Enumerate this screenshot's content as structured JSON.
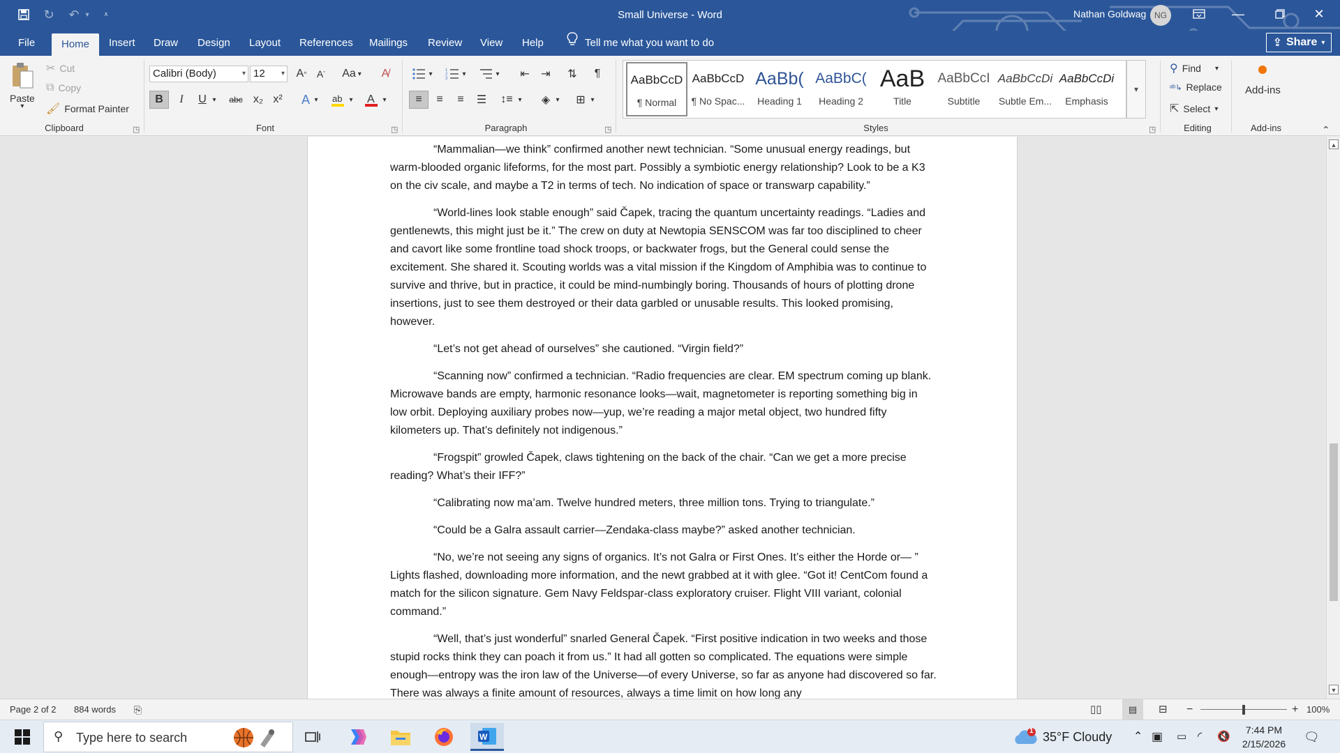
{
  "app": {
    "doc_title": "Small Universe  -  Word",
    "user_name": "Nathan Goldwag",
    "user_initials": "NG"
  },
  "menu": {
    "tabs": [
      "File",
      "Home",
      "Insert",
      "Draw",
      "Design",
      "Layout",
      "References",
      "Mailings",
      "Review",
      "View",
      "Help"
    ],
    "active_tab": "Home",
    "tell_me": "Tell me what you want to do",
    "share": "Share"
  },
  "ribbon": {
    "clipboard": {
      "paste": "Paste",
      "cut": "Cut",
      "copy": "Copy",
      "format_painter": "Format Painter",
      "label": "Clipboard"
    },
    "font": {
      "font_name": "Calibri (Body)",
      "font_size": "12",
      "label": "Font",
      "change_case": "Aa",
      "bold": "B",
      "italic": "I",
      "underline": "U",
      "strikethrough": "abc",
      "subscript": "x₂",
      "superscript": "x²"
    },
    "paragraph": {
      "label": "Paragraph"
    },
    "styles": {
      "label": "Styles",
      "items": [
        {
          "sample": "AaBbCcD",
          "name": "¶ Normal"
        },
        {
          "sample": "AaBbCcD",
          "name": "¶ No Spac..."
        },
        {
          "sample": "AaBb(",
          "name": "Heading 1"
        },
        {
          "sample": "AaBbC(",
          "name": "Heading 2"
        },
        {
          "sample": "AaB",
          "name": "Title"
        },
        {
          "sample": "AaBbCcI",
          "name": "Subtitle"
        },
        {
          "sample": "AaBbCcDi",
          "name": "Subtle Em..."
        },
        {
          "sample": "AaBbCcDi",
          "name": "Emphasis"
        }
      ]
    },
    "editing": {
      "find": "Find",
      "replace": "Replace",
      "select": "Select",
      "label": "Editing"
    },
    "addins": {
      "button": "Add-ins",
      "label": "Add-ins"
    }
  },
  "document": {
    "paragraphs": [
      "“Mammalian—we think” confirmed another newt technician. “Some unusual energy readings, but warm-blooded organic lifeforms, for the most part. Possibly a symbiotic energy relationship? Look to be a K3 on the civ scale, and maybe a T2 in terms of tech. No indication of space or transwarp capability.”",
      "“World-lines look stable enough” said Čapek, tracing the quantum uncertainty readings. “Ladies and gentlenewts, this might just be it.” The crew on duty at Newtopia SENSCOM was far too disciplined to cheer and cavort like some frontline toad shock troops, or backwater frogs, but the General could sense the excitement. She shared it. Scouting worlds was a vital mission if the Kingdom of Amphibia was to continue to survive and thrive, but in practice, it could be mind-numbingly boring. Thousands of hours of plotting drone insertions, just to see them destroyed or their data garbled or unusable results. This looked promising, however.",
      "“Let’s not get ahead of ourselves” she cautioned. “Virgin field?”",
      "“Scanning now” confirmed a technician. “Radio frequencies are clear. EM spectrum coming up blank. Microwave bands are empty, harmonic resonance looks—wait, magnetometer is reporting something big in low orbit. Deploying auxiliary probes now—yup, we’re reading a major metal object, two hundred fifty kilometers up. That’s definitely not indigenous.”",
      "“Frogspit” growled Čapek, claws tightening on the back of the chair. “Can we get a more precise reading? What’s their IFF?”",
      "“Calibrating now ma’am. Twelve hundred meters, three million tons. Trying to triangulate.”",
      "“Could be a Galra assault carrier—Zendaka-class maybe?” asked another technician.",
      "“No, we’re not seeing any signs of organics. It’s not Galra or First Ones. It’s either the Horde or— ” Lights flashed, downloading more information, and the newt grabbed at it with glee. “Got it! CentCom found a match for the silicon signature. Gem Navy Feldspar-class exploratory cruiser. Flight VIII variant, colonial command.”",
      "“Well, that’s just wonderful” snarled General Čapek. “First positive indication in two weeks and those stupid rocks think they can poach it from us.” It had all gotten so complicated. The equations were simple enough—entropy was the iron law of the Universe—of every Universe, so far as anyone had discovered so far. There was always a finite amount of resources, always a time limit on how long any"
    ]
  },
  "status": {
    "page": "Page 2 of 2",
    "words": "884 words",
    "zoom": "100%",
    "zoom_level_percent": 100
  },
  "taskbar": {
    "search_placeholder": "Type here to search",
    "weather": "35°F  Cloudy",
    "weather_badge": "1",
    "time": "7:44 PM",
    "date": "2/15/2026"
  }
}
